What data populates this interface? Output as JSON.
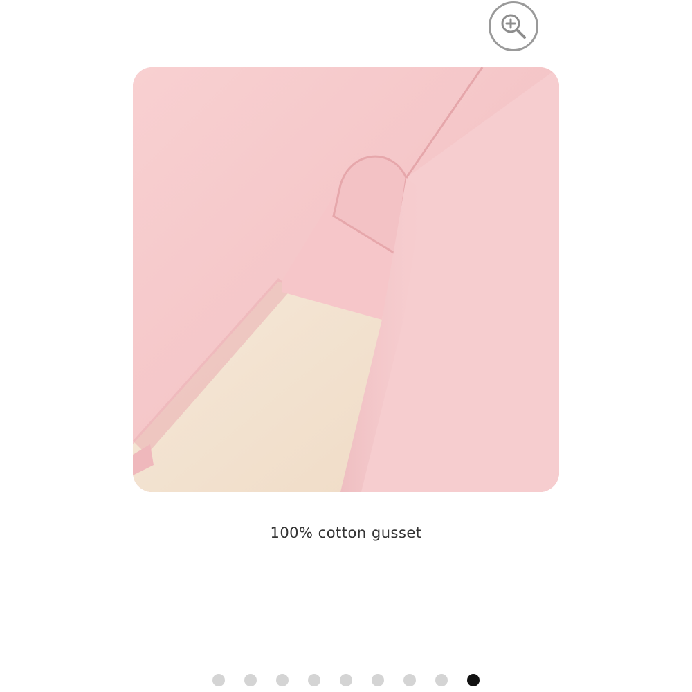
{
  "zoom": {
    "icon": "zoom-in-icon",
    "aria_label": "Zoom in"
  },
  "product_image": {
    "alt": "Pink fabric with cream 100% cotton gusset lining"
  },
  "caption": "100% cotton gusset",
  "pagination": {
    "total": 9,
    "active_index": 8
  },
  "colors": {
    "fabric_pink": "#f5c8ca",
    "gusset_cream": "#f4e5d3",
    "active_dot": "#111111",
    "inactive_dot": "#d4d4d4"
  }
}
